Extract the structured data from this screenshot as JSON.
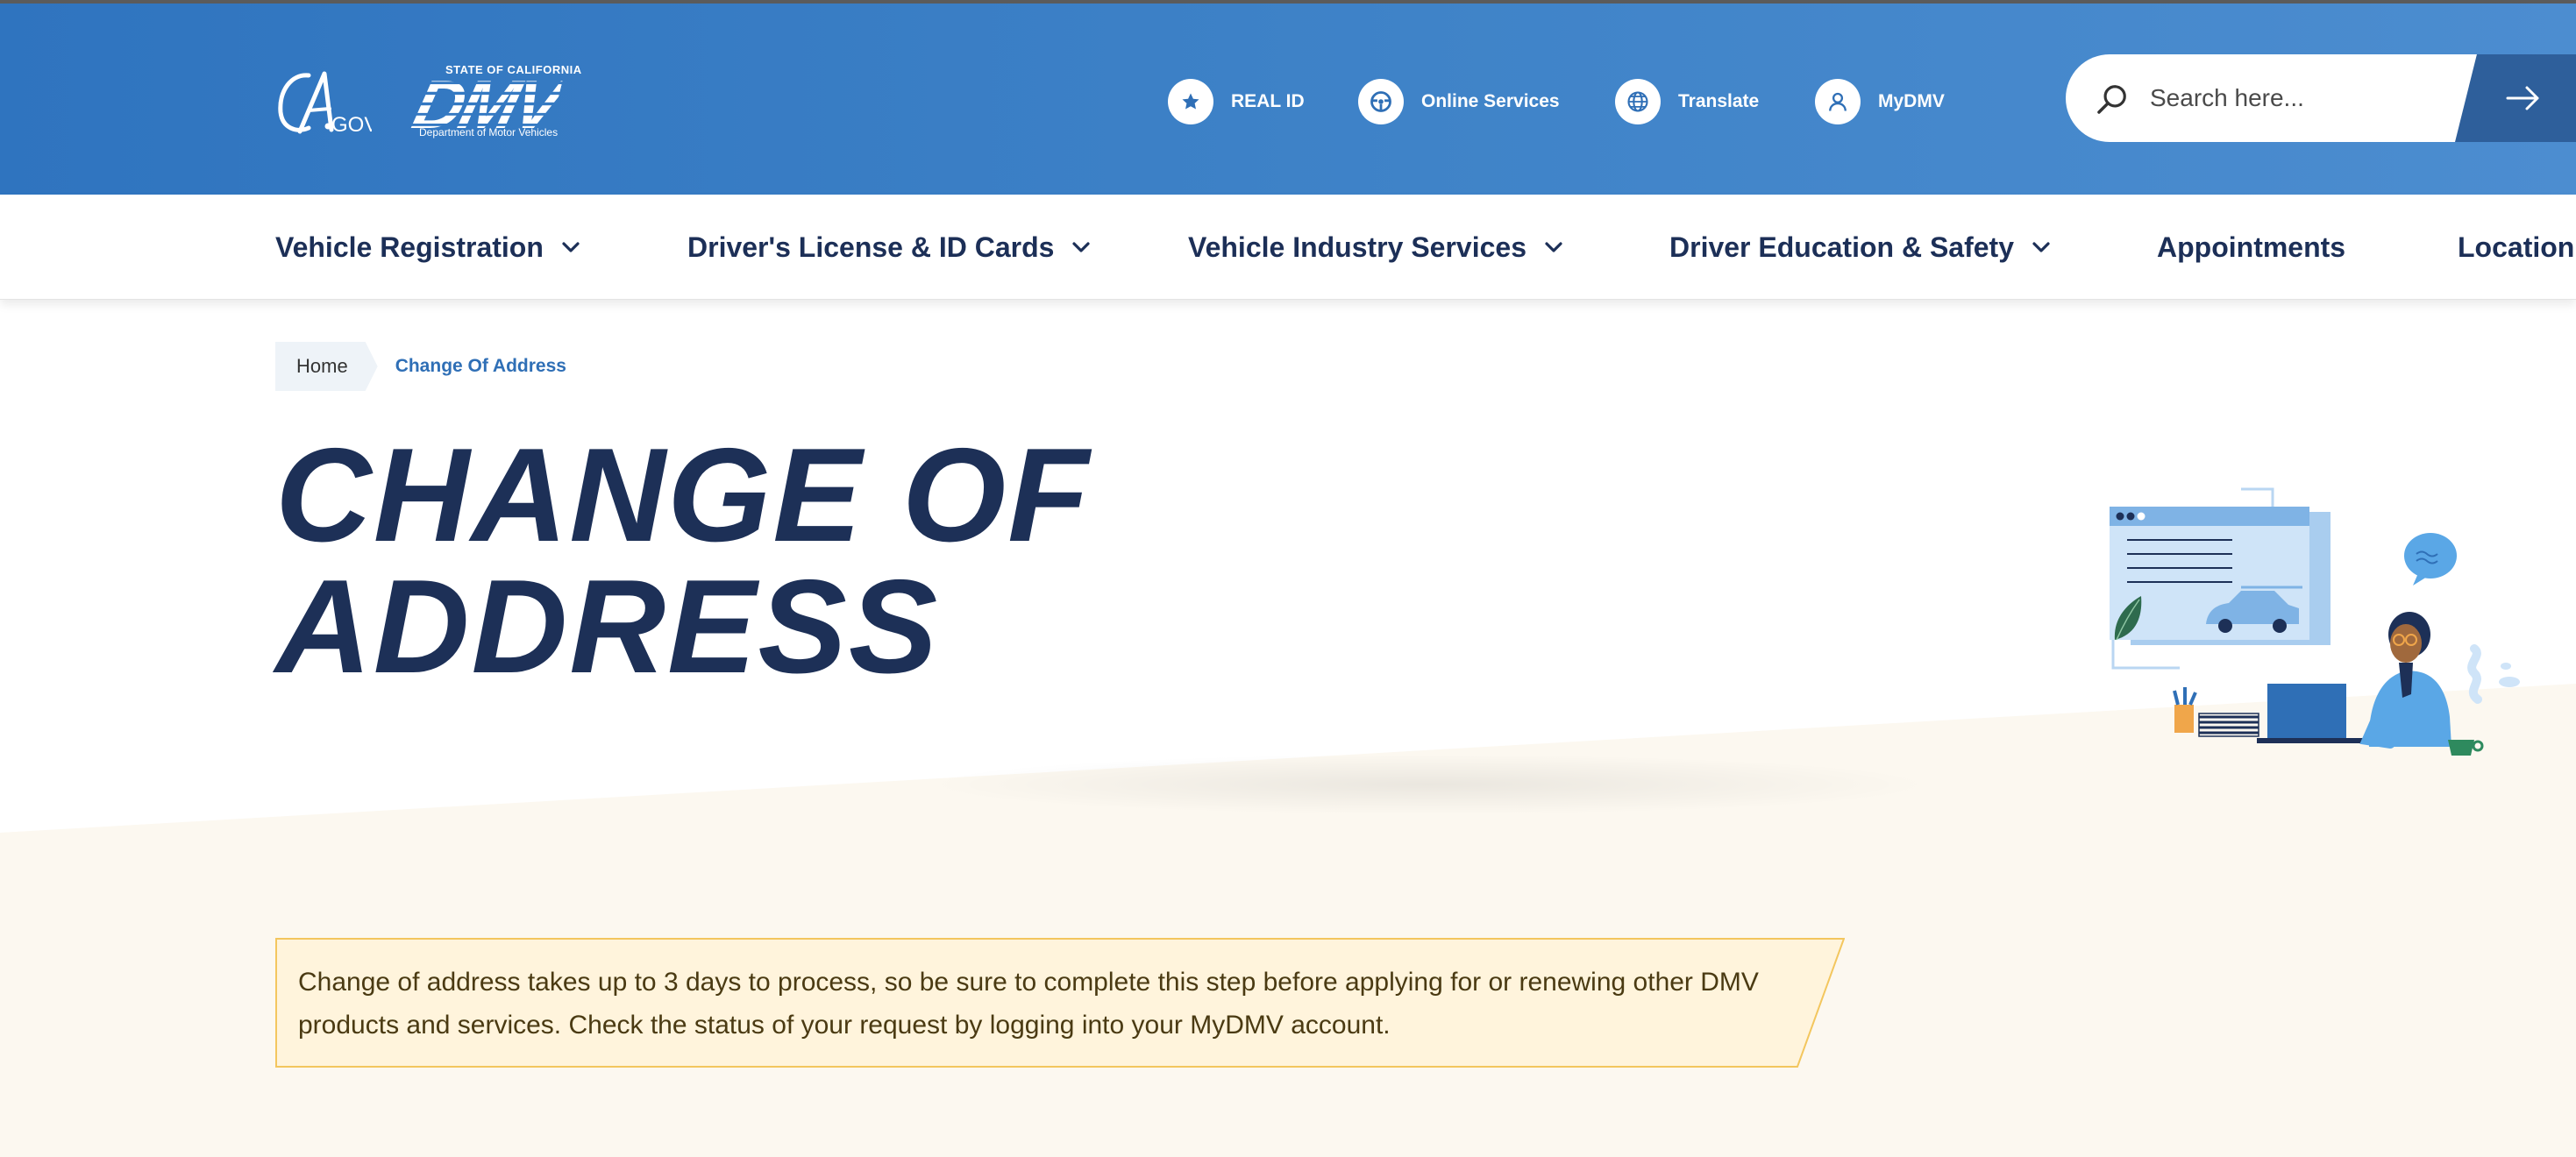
{
  "header": {
    "cagov_logo_text": "CA.GOV",
    "dmv_logo": {
      "state_text": "STATE OF CALIFORNIA",
      "word": "DMV",
      "department_text": "Department of Motor Vehicles"
    },
    "utility_links": [
      {
        "label": "REAL ID",
        "icon": "star-icon"
      },
      {
        "label": "Online Services",
        "icon": "steering-wheel-icon"
      },
      {
        "label": "Translate",
        "icon": "globe-icon"
      },
      {
        "label": "MyDMV",
        "icon": "user-icon"
      }
    ],
    "search": {
      "placeholder": "Search here..."
    }
  },
  "nav": {
    "items": [
      {
        "label": "Vehicle Registration",
        "has_dropdown": true
      },
      {
        "label": "Driver's License & ID Cards",
        "has_dropdown": true
      },
      {
        "label": "Vehicle Industry Services",
        "has_dropdown": true
      },
      {
        "label": "Driver Education & Safety",
        "has_dropdown": true
      },
      {
        "label": "Appointments",
        "has_dropdown": false
      },
      {
        "label": "Location",
        "has_dropdown": false
      }
    ]
  },
  "breadcrumb": {
    "home": "Home",
    "current": "Change Of Address"
  },
  "page": {
    "title_line1": "CHANGE OF",
    "title_line2": "ADDRESS"
  },
  "notice": {
    "text": "Change of address takes up to 3 days to process, so be sure to complete this step before applying for or renewing other DMV products and services. Check the status of your request by logging into your MyDMV account."
  },
  "colors": {
    "header_blue": "#3f83c8",
    "navy_text": "#1d3057",
    "link_blue": "#2f6fb6",
    "notice_bg": "#fff4dc",
    "notice_border": "#f3c65e",
    "cream_band": "#fcf8f0"
  }
}
